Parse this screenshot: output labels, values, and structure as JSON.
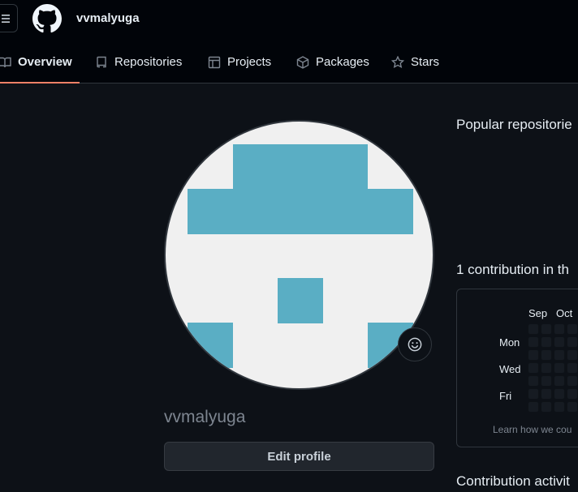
{
  "header": {
    "username": "vvmalyuga"
  },
  "tabs": [
    {
      "label": "Overview",
      "icon": "book-icon",
      "active": true
    },
    {
      "label": "Repositories",
      "icon": "repo-icon",
      "active": false
    },
    {
      "label": "Projects",
      "icon": "table-icon",
      "active": false
    },
    {
      "label": "Packages",
      "icon": "package-icon",
      "active": false
    },
    {
      "label": "Stars",
      "icon": "star-icon",
      "active": false
    }
  ],
  "profile": {
    "name": "vvmalyuga",
    "edit_label": "Edit profile"
  },
  "right": {
    "popular_title": "Popular repositorie",
    "contrib_title": "1 contribution in th",
    "activity_title": "Contribution activit",
    "months": [
      "Sep",
      "Oct"
    ],
    "days": [
      "Mon",
      "Wed",
      "Fri"
    ],
    "learn_text": "Learn how we cou"
  },
  "colors": {
    "accent": "#f78166",
    "avatar_blue": "#5aaec4",
    "background": "#0d1117"
  }
}
